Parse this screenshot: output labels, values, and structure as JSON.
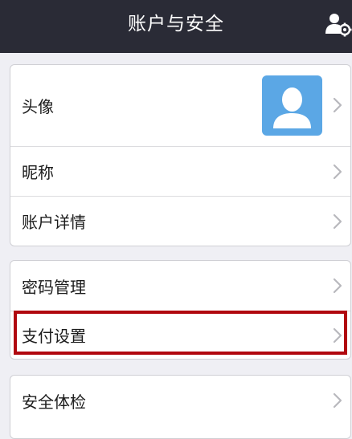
{
  "header": {
    "title": "账户与安全",
    "action_icon": "user-settings-icon"
  },
  "sections": [
    {
      "items": [
        {
          "label": "头像",
          "avatar_icon": "default-avatar-icon"
        },
        {
          "label": "昵称"
        },
        {
          "label": "账户详情"
        }
      ]
    },
    {
      "items": [
        {
          "label": "密码管理"
        },
        {
          "label": "支付设置",
          "highlighted": true
        }
      ]
    },
    {
      "items": [
        {
          "label": "安全体检"
        }
      ]
    }
  ],
  "colors": {
    "nav_background": "#2a2b36",
    "page_background": "#efeff4",
    "avatar_background": "#5ba7e5",
    "highlight_border": "#b0070f"
  }
}
